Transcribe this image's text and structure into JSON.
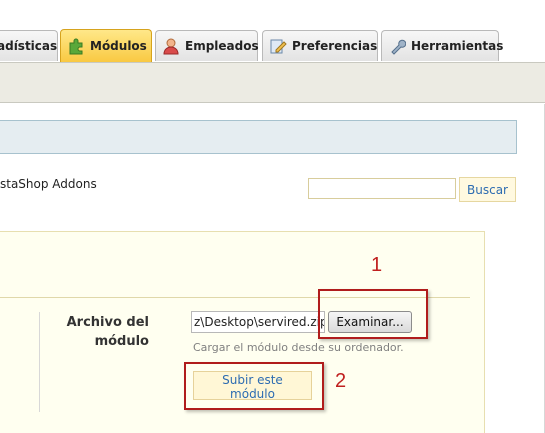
{
  "tabs": [
    {
      "label": "adísticas",
      "icon": "stats-icon"
    },
    {
      "label": "Módulos",
      "icon": "puzzle-icon",
      "active": true
    },
    {
      "label": "Empleados",
      "icon": "user-icon"
    },
    {
      "label": "Preferencias",
      "icon": "pencil-icon"
    },
    {
      "label": "Herramientas",
      "icon": "wrench-icon"
    }
  ],
  "addons": {
    "text": "staShop Addons"
  },
  "search": {
    "placeholder": "",
    "button_label": "Buscar"
  },
  "upload": {
    "label_line1": "Archivo del",
    "label_line2": "módulo",
    "file_value": "z\\Desktop\\servired.zip",
    "browse_label": "Examinar...",
    "hint": "Cargar el módulo desde su ordenador.",
    "submit_label": "Subir este módulo"
  },
  "annotations": {
    "one": "1",
    "two": "2"
  },
  "colors": {
    "active_tab": "#f9c942",
    "link_blue": "#2d6cb1",
    "annotation_red": "#b01c1c"
  }
}
